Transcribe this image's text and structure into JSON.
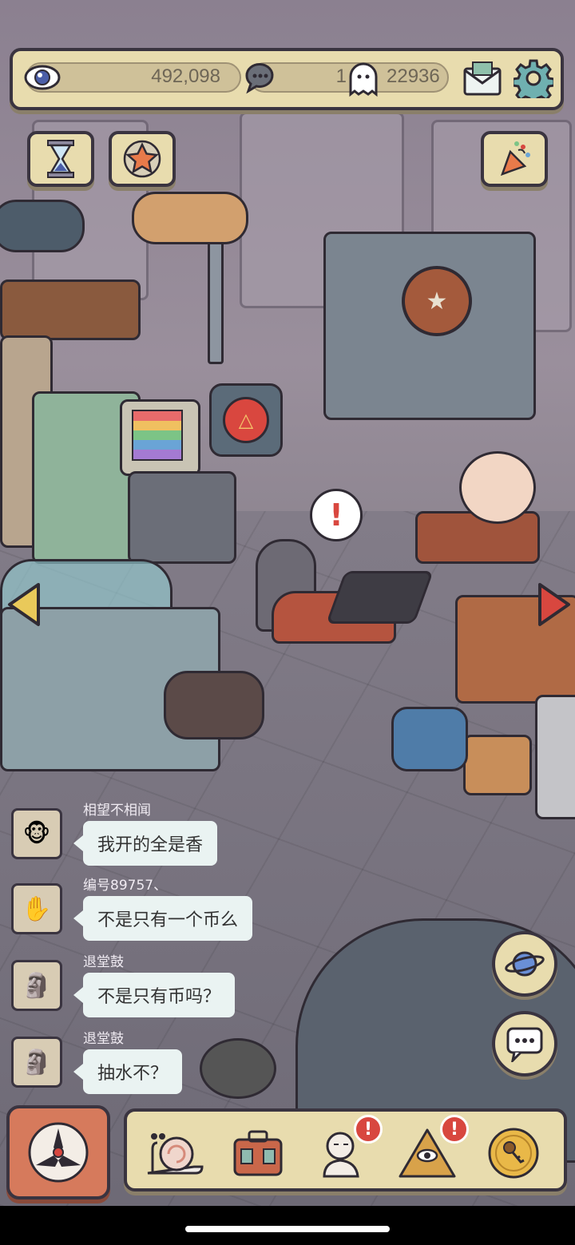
{
  "resources": {
    "eye_count": "492,098",
    "chat_count": "1",
    "ghost_count": "22936"
  },
  "chat_messages": [
    {
      "user": "相望不相闻",
      "text": "我开的全是香"
    },
    {
      "user": "编号89757、",
      "text": "不是只有一个币么"
    },
    {
      "user": "退堂鼓",
      "text": "不是只有币吗？"
    },
    {
      "user": "退堂鼓",
      "text": "抽水不？"
    }
  ],
  "alert_mark": "!",
  "colors": {
    "panel": "#e8dcae",
    "outline": "#3a3440",
    "badge": "#d8473f",
    "bubble": "#eaf3f2"
  },
  "icons": [
    "eye-icon",
    "speech-bubble-icon",
    "ghost-icon",
    "mail-icon",
    "gear-icon",
    "hourglass-icon",
    "star-icon",
    "party-popper-icon",
    "planet-icon",
    "chat-icon",
    "snail-icon",
    "suitcase-icon",
    "bust-icon",
    "pyramid-eye-icon",
    "key-coin-icon",
    "compass-icon"
  ],
  "bottom_badges": {
    "bust": "!",
    "pyramid": "!"
  }
}
